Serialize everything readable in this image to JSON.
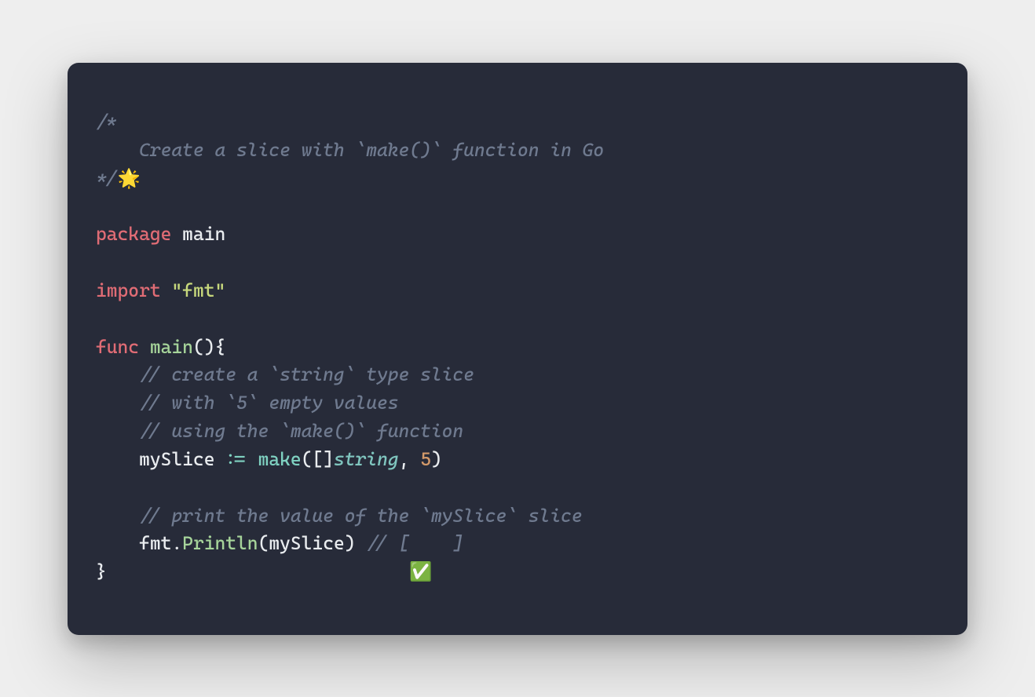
{
  "code": {
    "block_comment_open": "/*",
    "block_comment_body": "    Create a slice with `make()` function in Go",
    "block_comment_close_prefix": "*/",
    "block_comment_emoji": "🌟",
    "kw_package": "package",
    "pkg_name": "main",
    "kw_import": "import",
    "import_pkg": "\"fmt\"",
    "kw_func": "func",
    "func_name": "main",
    "func_sig_open": "()",
    "brace_open": "{",
    "cmt_create1": "// create a `string` type slice",
    "cmt_create2": "// with `5` empty values",
    "cmt_create3": "// using the `make()` function",
    "var_name": "mySlice",
    "op_assign": ":=",
    "builtin_make": "make",
    "paren_open": "(",
    "slice_brackets_open": "[",
    "slice_brackets_close": "]",
    "type_string": "string",
    "comma": ",",
    "num_five": "5",
    "paren_close": ")",
    "cmt_print": "// print the value of the `mySlice` slice",
    "fmt_pkg": "fmt",
    "dot": ".",
    "println": "Println",
    "println_arg": "mySlice",
    "tail_comment": "// [    ]",
    "brace_close": "}",
    "check_emoji": "✅",
    "check_pad": "                            "
  }
}
